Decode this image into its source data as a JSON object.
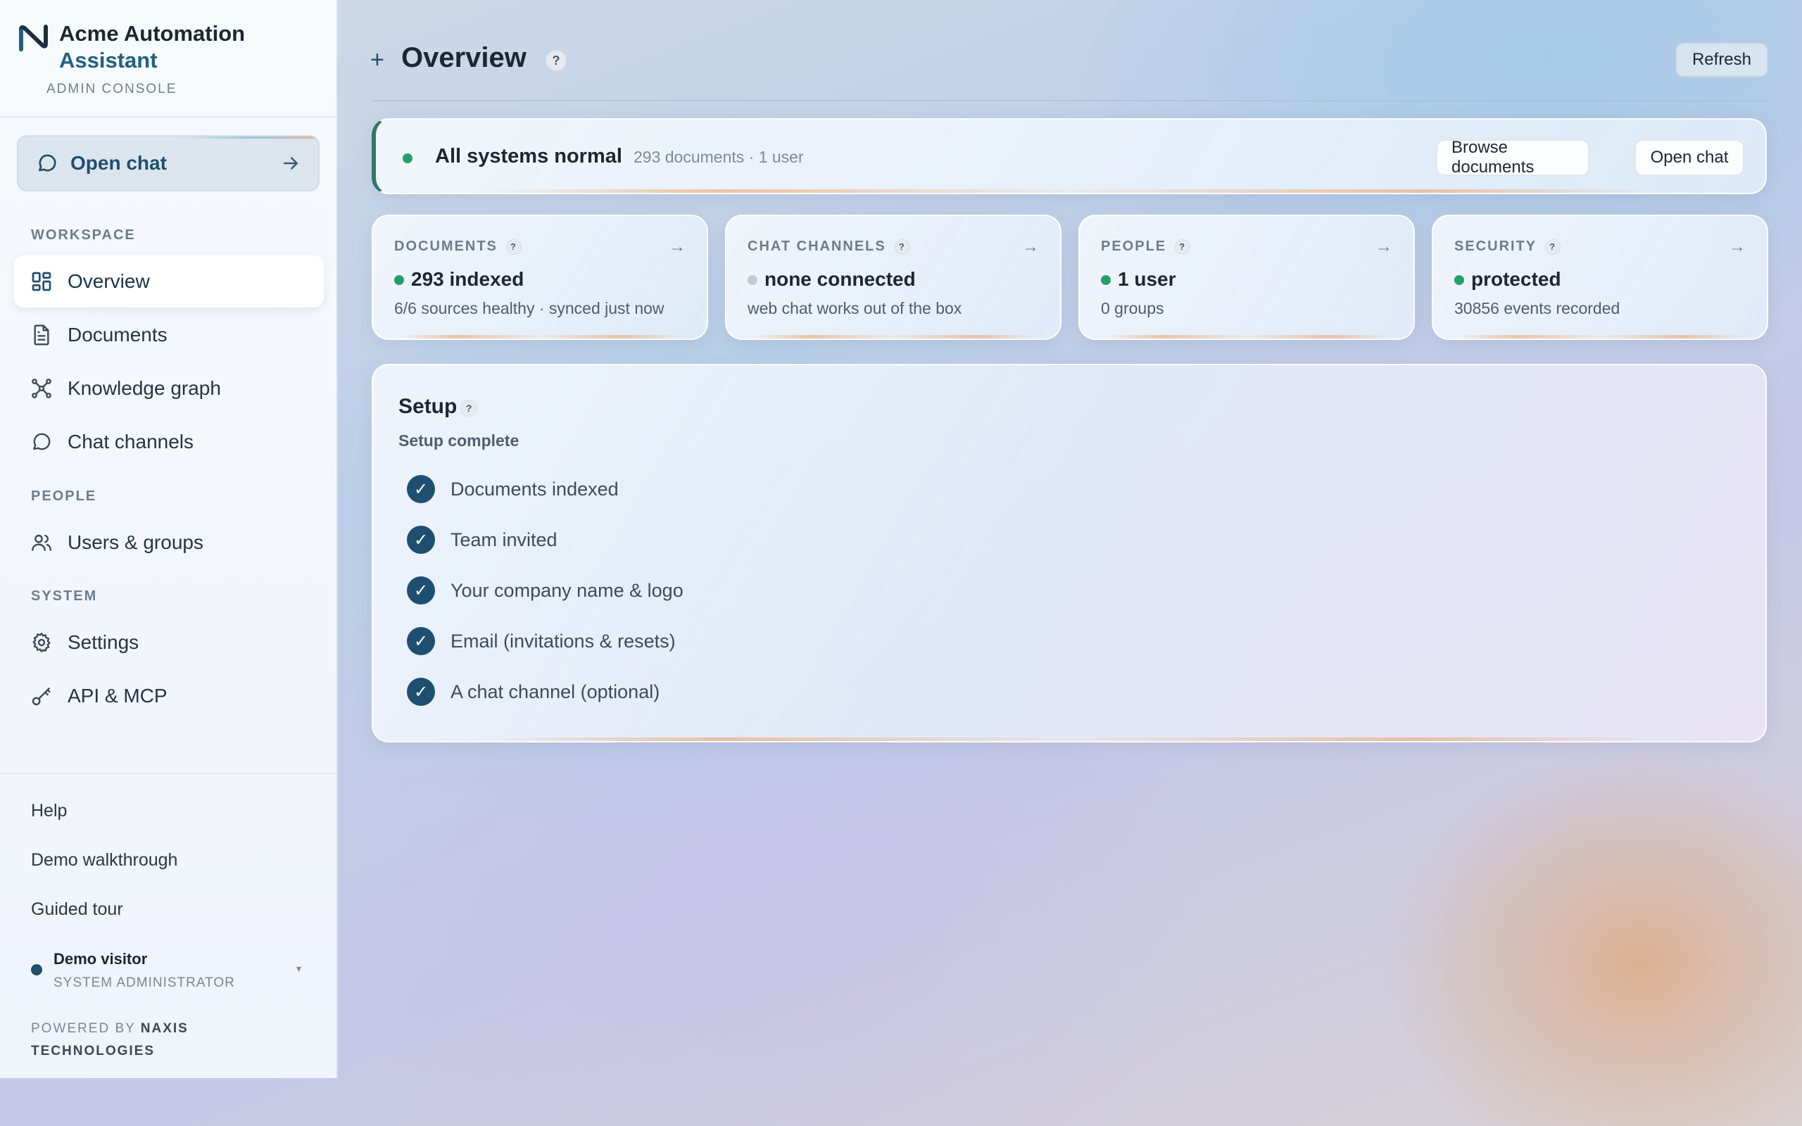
{
  "brand": {
    "title_line1": "Acme Automation",
    "title_line2": "Assistant",
    "subtitle": "ADMIN CONSOLE"
  },
  "sidebar": {
    "open_chat_label": "Open chat",
    "sections": {
      "workspace": "WORKSPACE",
      "people": "PEOPLE",
      "system": "SYSTEM"
    },
    "items": [
      {
        "label": "Overview",
        "icon": "grid-icon",
        "active": true
      },
      {
        "label": "Documents",
        "icon": "document-icon"
      },
      {
        "label": "Knowledge graph",
        "icon": "graph-icon"
      },
      {
        "label": "Chat channels",
        "icon": "chat-bubble-icon"
      },
      {
        "label": "Users & groups",
        "icon": "users-icon"
      },
      {
        "label": "Settings",
        "icon": "gear-icon"
      },
      {
        "label": "API & MCP",
        "icon": "key-icon"
      }
    ],
    "footer_links": [
      "Help",
      "Demo walkthrough",
      "Guided tour"
    ],
    "user": {
      "name": "Demo visitor",
      "role": "SYSTEM ADMINISTRATOR"
    },
    "powered_by_prefix": "POWERED BY",
    "powered_by_name": "NAXIS TECHNOLOGIES"
  },
  "header": {
    "title": "Overview",
    "refresh_label": "Refresh"
  },
  "status": {
    "title": "All systems normal",
    "summary": "293 documents · 1 user",
    "browse_label": "Browse documents",
    "open_chat_label": "Open chat",
    "color": "#22a06b"
  },
  "stats": [
    {
      "label": "DOCUMENTS",
      "value": "293 indexed",
      "detail": "6/6 sources healthy · synced just now",
      "dot_color": "#22a06b"
    },
    {
      "label": "CHAT CHANNELS",
      "value": "none connected",
      "detail": "web chat works out of the box",
      "dot_color": "#c3cbd4"
    },
    {
      "label": "PEOPLE",
      "value": "1 user",
      "detail": "0 groups",
      "dot_color": "#22a06b"
    },
    {
      "label": "SECURITY",
      "value": "protected",
      "detail": "30856 events recorded",
      "dot_color": "#22a06b"
    }
  ],
  "setup": {
    "title": "Setup",
    "status": "Setup complete",
    "items": [
      {
        "label": "Documents indexed",
        "done": true
      },
      {
        "label": "Team invited",
        "done": true
      },
      {
        "label": "Your company name & logo",
        "done": true
      },
      {
        "label": "Email (invitations & resets)",
        "done": true
      },
      {
        "label": "A chat channel (optional)",
        "done": true
      }
    ]
  },
  "glyphs": {
    "help": "?",
    "plus": "+",
    "arrow": "→",
    "check": "✓",
    "caret": "▾"
  },
  "colors": {
    "accent": "#1f4e6e",
    "success": "#22a06b",
    "inactive": "#c3cbd4"
  }
}
